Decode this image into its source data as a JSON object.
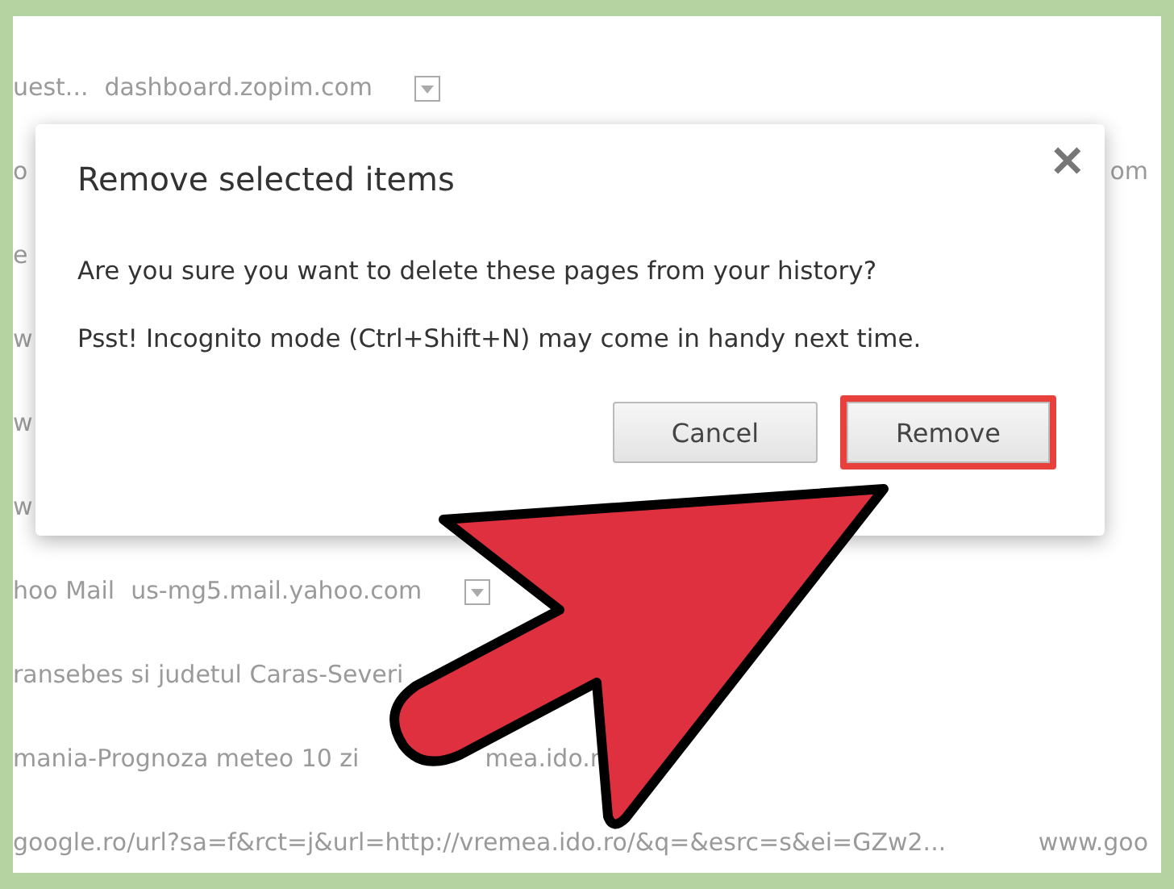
{
  "history_rows": [
    {
      "title": "uest...",
      "url": "dashboard.zopim.com",
      "menu": true
    },
    {
      "title": "o",
      "far": "om"
    },
    {
      "title": "e"
    },
    {
      "title": "w"
    },
    {
      "title": "w"
    },
    {
      "title": "w"
    },
    {
      "title": "hoo Mail",
      "url": "us-mg5.mail.yahoo.com",
      "menu": true
    },
    {
      "title": "ransebes si judetul Caras-Severi"
    },
    {
      "title": "mania-Prognoza meteo 10 zi",
      "url": "mea.ido.r"
    },
    {
      "title": "google.ro/url?sa=f&rct=j&url=http://vremea.ido.ro/&q=&esrc=s&ei=GZw2...",
      "far": "www.goo"
    }
  ],
  "dialog": {
    "title": "Remove selected items",
    "close": "✕",
    "message": "Are you sure you want to delete these pages from your history?",
    "note": "Psst! Incognito mode (Ctrl+Shift+N) may come in handy next time.",
    "buttons": [
      {
        "label": "Cancel",
        "highlighted": false
      },
      {
        "label": "Remove",
        "highlighted": true
      }
    ]
  }
}
